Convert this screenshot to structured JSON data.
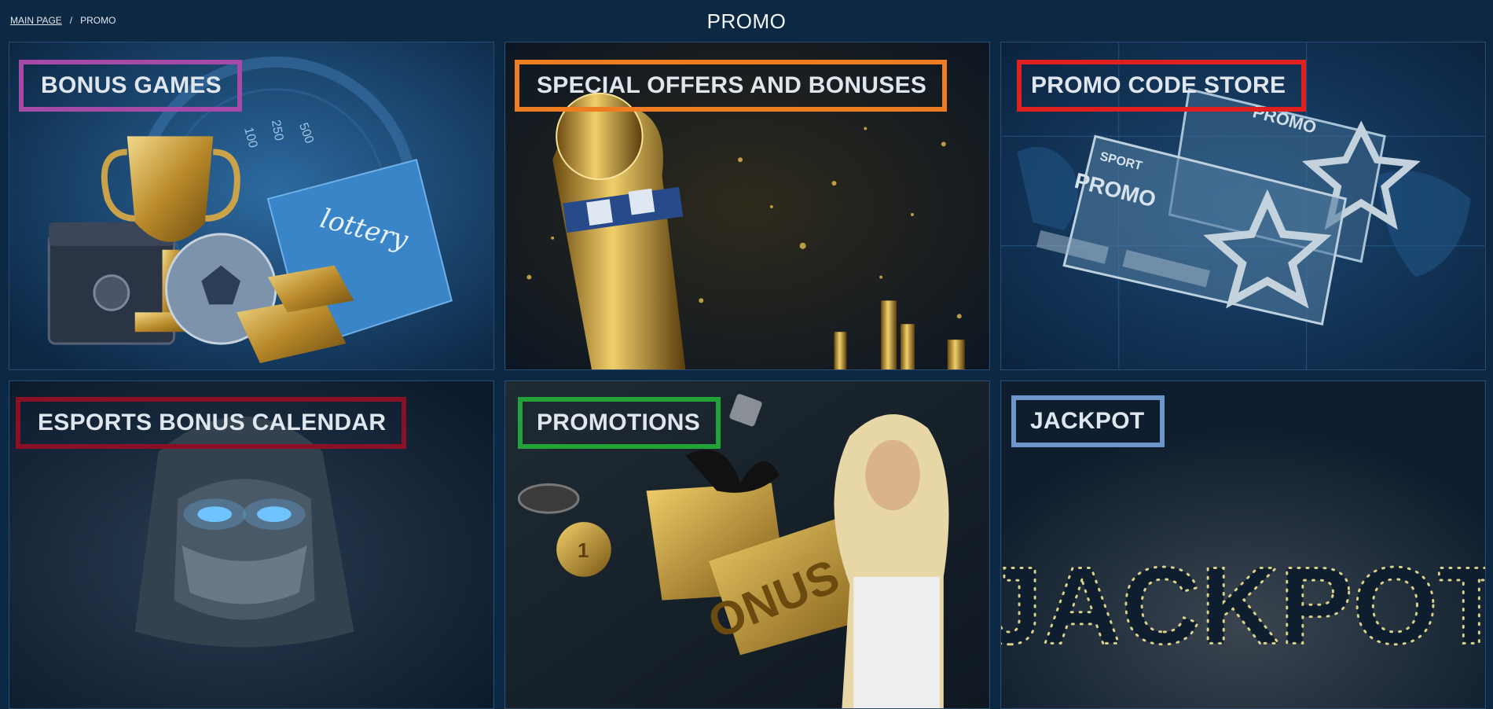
{
  "breadcrumb": {
    "home": "MAIN PAGE",
    "separator": "/",
    "current": "PROMO"
  },
  "page_title": "PROMO",
  "cards": [
    {
      "label": "BONUS GAMES",
      "art": [
        "100",
        "250",
        "500",
        "lottery"
      ]
    },
    {
      "label": "SPECIAL OFFERS AND BONUSES"
    },
    {
      "label": "PROMO CODE STORE",
      "art": [
        "SPORT",
        "PROMO",
        "PROMO"
      ]
    },
    {
      "label": "ESPORTS BONUS CALENDAR"
    },
    {
      "label": "PROMOTIONS",
      "art": [
        "ONUS",
        "1"
      ]
    },
    {
      "label": "JACKPOT",
      "art": [
        "JACKPOT"
      ]
    }
  ],
  "colors": {
    "background": "#0d2843",
    "bonus_games_border": "#a64aa8",
    "special_offers_border": "#ee7d22",
    "promo_code_border": "#e0201f",
    "esports_border": "#8a1025",
    "promotions_border": "#22a33a",
    "jackpot_border": "#6f96c8"
  }
}
